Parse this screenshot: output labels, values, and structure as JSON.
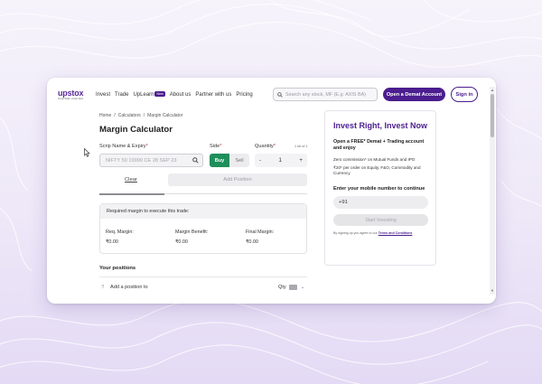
{
  "brand": {
    "name": "upstox",
    "tagline": "Invest Right, Invest Now"
  },
  "nav": {
    "links": [
      "Invest",
      "Trade",
      "UpLearn",
      "About us",
      "Partner with us",
      "Pricing"
    ],
    "new_badge": "New"
  },
  "search": {
    "placeholder": "Search any stock, MF (E.g: AXIS BA)"
  },
  "header_buttons": {
    "open_demat": "Open a Demat Account",
    "sign_in": "Sign in"
  },
  "breadcrumb": [
    "Home",
    "/",
    "Calculators",
    "/",
    "Margin Calculator"
  ],
  "calculator": {
    "title": "Margin Calculator",
    "scrip_label": "Scrip Name & Expiry",
    "scrip_placeholder": "NIFTY 50 19990 CE 28 SEP 23",
    "side_label": "Side",
    "side_options": [
      "Buy",
      "Sell"
    ],
    "side_selected": "Buy",
    "quantity_label": "Quantity",
    "lot_info": "1 lot of 1",
    "quantity_value": "1",
    "minus": "-",
    "plus": "+",
    "required_mark": "*",
    "clear_label": "Clear",
    "add_position_label": "Add Position"
  },
  "margin": {
    "heading": "Required margin to execute this trade:",
    "req_label": "Req. Margin:",
    "req_value": "₹0.00",
    "benefit_label": "Margin Benefit:",
    "benefit_value": "₹0.00",
    "final_label": "Final Margin:",
    "final_value": "₹0.00"
  },
  "positions": {
    "title": "Your positions",
    "row_label": "Add a position to",
    "qty_label": "Qty"
  },
  "promo": {
    "title": "Invest Right, Invest Now",
    "subtitle": "Open a FREE* Demat + Trading account and enjoy",
    "point1": "Zero commission* on Mutual Funds and IPO",
    "point2": "₹20* per order on Equity, F&O, Commodity and Currency",
    "mobile_label": "Enter your mobile number to continue",
    "mobile_value": "+91",
    "start_button": "Start Investing",
    "terms_prefix": "By signing up you agree to our",
    "terms_link": "Terms and Conditions"
  },
  "colors": {
    "brand_purple": "#4b1d8f",
    "buy_green": "#1e8f5a"
  }
}
